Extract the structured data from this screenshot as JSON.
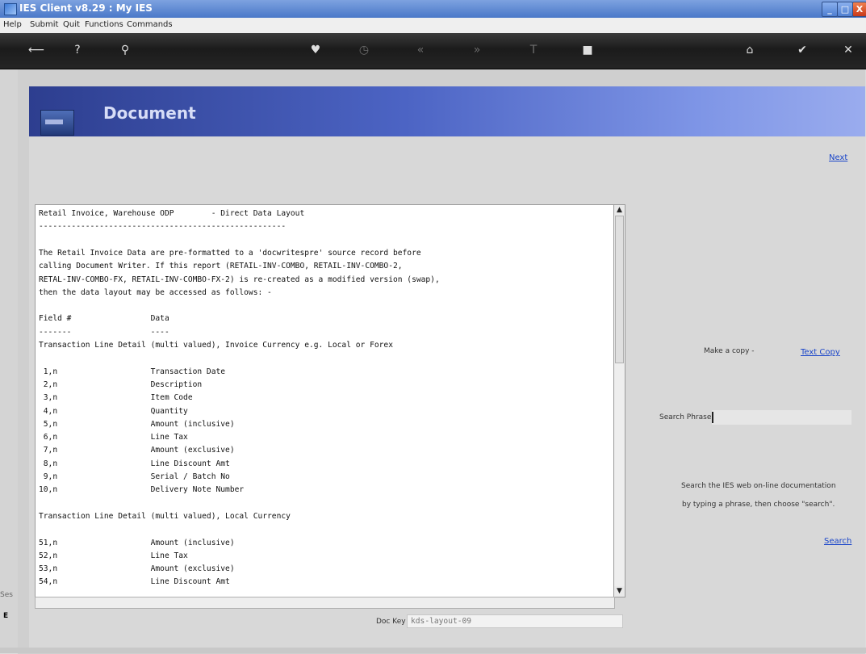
{
  "window": {
    "title": "IES Client v8.29 : My IES",
    "min": "_",
    "max": "□",
    "close": "X"
  },
  "menu": [
    "Help",
    "Submit",
    "Quit",
    "Functions",
    "Commands"
  ],
  "toolbar": {
    "icons": [
      "back-icon",
      "help-icon",
      "search-icon",
      "heart-icon",
      "clock-icon",
      "rewind-icon",
      "forward-icon",
      "text-icon",
      "stop-icon",
      "home-icon",
      "check-icon",
      "close-icon"
    ]
  },
  "header": {
    "title": "Document"
  },
  "nav": {
    "next": "Next"
  },
  "document": {
    "lines": [
      "Retail Invoice, Warehouse ODP        - Direct Data Layout",
      "-----------------------------------------------------",
      "",
      "The Retail Invoice Data are pre-formatted to a 'docwritespre' source record before",
      "calling Document Writer. If this report (RETAIL-INV-COMBO, RETAIL-INV-COMBO-2,",
      "RETAL-INV-COMBO-FX, RETAIL-INV-COMBO-FX-2) is re-created as a modified version (swap),",
      "then the data layout may be accessed as follows: -",
      "",
      "Field #                 Data",
      "-------                 ----",
      "Transaction Line Detail (multi valued), Invoice Currency e.g. Local or Forex",
      "",
      " 1,n                    Transaction Date",
      " 2,n                    Description",
      " 3,n                    Item Code",
      " 4,n                    Quantity",
      " 5,n                    Amount (inclusive)",
      " 6,n                    Line Tax",
      " 7,n                    Amount (exclusive)",
      " 8,n                    Line Discount Amt",
      " 9,n                    Serial / Batch No",
      "10,n                    Delivery Note Number",
      "",
      "Transaction Line Detail (multi valued), Local Currency",
      "",
      "51,n                    Amount (inclusive)",
      "52,n                    Line Tax",
      "53,n                    Amount (exclusive)",
      "54,n                    Line Discount Amt"
    ]
  },
  "side": {
    "copy_label": "Make a copy -",
    "copy_link": "Text Copy",
    "search_label": "Search Phrase",
    "search_value": "",
    "help_line1": "Search the IES web on-line documentation",
    "help_line2": "by typing a phrase, then choose \"search\".",
    "search_link": "Search"
  },
  "footer": {
    "doc_key_label": "Doc Key",
    "doc_key_value": "kds-layout-09",
    "left_label": "Ses"
  }
}
